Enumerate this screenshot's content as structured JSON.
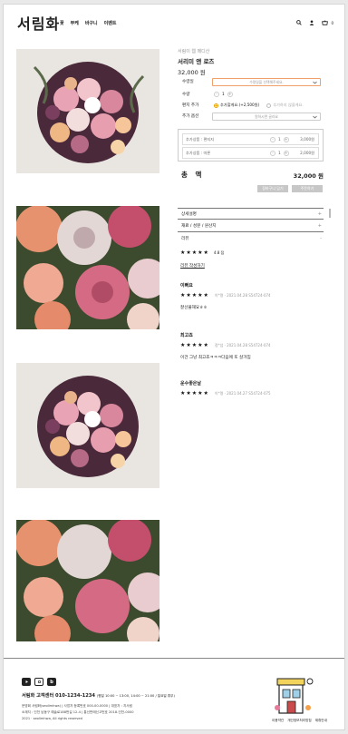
{
  "header": {
    "logo": "서림화",
    "nav": [
      "꽃",
      "부케",
      "바구니",
      "이벤트"
    ],
    "cart_count": "0",
    "icons": [
      "search-icon",
      "user-icon",
      "cart-icon"
    ]
  },
  "product": {
    "subtitle": "서림이 웹 메디산",
    "name": "서리미 앤 로즈",
    "price": "32,000 원"
  },
  "options": {
    "date_label": "수령일",
    "date_placeholder": "수령일을 선택해주세요.",
    "qty_label": "수량",
    "qty_minus": "-",
    "qty_value": "1",
    "qty_plus": "+",
    "letter_label": "편지 추가",
    "letter_opt1": "추가할게요.(+2,500원)",
    "letter_opt2": "추가하지 않을게요.",
    "extra_label": "추가 옵션",
    "extra_placeholder": "원하시면 골라요",
    "lines": [
      {
        "name": "추가상품 : 편지지",
        "minus": "-",
        "qty": "1",
        "plus": "+",
        "price": "3,000원"
      },
      {
        "name": "추가상품 : 마론",
        "minus": "-",
        "qty": "1",
        "plus": "+",
        "price": "2,000원"
      }
    ]
  },
  "total": {
    "label": "총 액",
    "value": "32,000 원",
    "btn_cart": "장바구니 담기",
    "btn_buy": "주문하기"
  },
  "accordion": [
    {
      "label": "상세설명",
      "mark": "+"
    },
    {
      "label": "재료 / 성분 / 원산지",
      "mark": "+"
    },
    {
      "label": "리뷰",
      "mark": "-"
    }
  ],
  "reviews_summary": {
    "stars": "★★★★★",
    "score": "4.8 점",
    "write_link": "리뷰 작성하기"
  },
  "reviews": [
    {
      "name": "이뻐요",
      "stars": "★★★★★",
      "meta": "이*명 · 2021.04.28  S54724-074",
      "text": "잘선물해요ㅎㅎ"
    },
    {
      "name": "최고죠",
      "stars": "★★★★★",
      "meta": "정*섭 · 2021.04.28  S54724-074",
      "text": "이건 그냥 최고죠ㅋㅋㅋ다음에 또 살거임"
    },
    {
      "name": "운수좋은날",
      "stars": "★★★★★",
      "meta": "이*명 · 2021.04.27  S54724-075",
      "text": ""
    }
  ],
  "footer": {
    "cs": "서림화 고객센터 010-1234-1234",
    "cs_hours": "(평일 10:00 ~ 13:00, 14:00 ~ 21:00 / 일요일 휴무)",
    "company": "운영회 서림화(seolimhwa) | 사업자 등록번호 000-00-0000 | 대표자 : 지서림",
    "address": "소재지 : 인천 남동구 예술로188번길 12-4 | 통신판매신고번호 2018-인천-0000",
    "copyright": "2021 · seolimhwa, All rights reserved",
    "links": [
      "이용약관",
      "개인정보처리방침",
      "제휴안내"
    ],
    "social_icons": [
      "youtube-icon",
      "instagram-icon",
      "blog-icon"
    ],
    "blog_glyph": "b"
  }
}
